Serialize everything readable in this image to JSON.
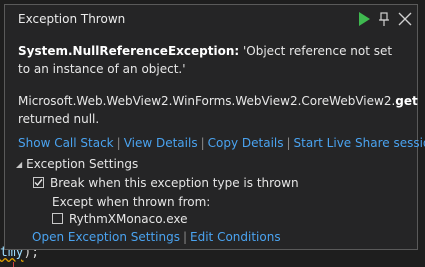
{
  "popup": {
    "title": "Exception Thrown",
    "exception_type": "System.NullReferenceException:",
    "exception_message": " 'Object reference not set to an instance of an object.'",
    "detail_prefix": "Microsoft.Web.WebView2.WinForms.WebView2.CoreWebView2.",
    "detail_bold": "get",
    "detail_suffix": " returned null.",
    "links": [
      "Show Call Stack",
      "View Details",
      "Copy Details",
      "Start Live Share session"
    ],
    "link_separator": "|"
  },
  "exception_settings": {
    "header": "Exception Settings",
    "break_label": "Break when this exception type is thrown",
    "break_checked": true,
    "except_label": "Except when thrown from:",
    "module_label": "RythmXMonaco.exe",
    "module_checked": false,
    "bottom_links": [
      "Open Exception Settings",
      "Edit Conditions"
    ]
  },
  "editor": {
    "ident": "tmy",
    "rest": ");"
  },
  "colors": {
    "link": "#4aa3f0",
    "play": "#3fb950",
    "background": "#1e1e1e",
    "popup": "#252526"
  }
}
